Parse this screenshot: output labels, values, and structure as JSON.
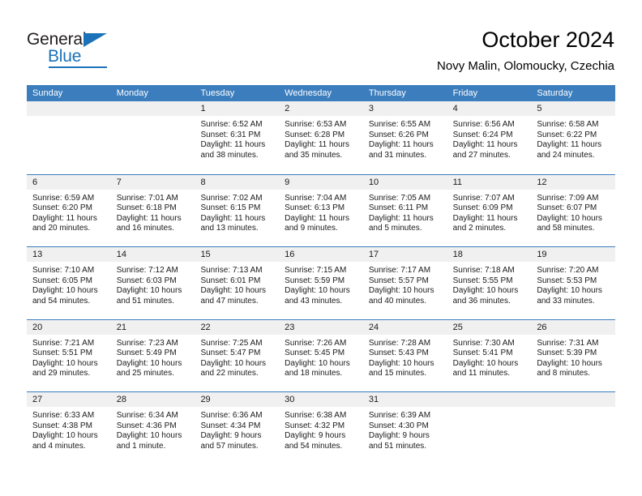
{
  "brand": {
    "name_top": "General",
    "name_bottom": "Blue",
    "accent_color": "#1b72b8"
  },
  "header": {
    "title": "October 2024",
    "subtitle": "Novy Malin, Olomoucky, Czechia"
  },
  "calendar": {
    "header_bg": "#3b7dbd",
    "day_band_bg": "#f0f0f0",
    "weekday_labels": [
      "Sunday",
      "Monday",
      "Tuesday",
      "Wednesday",
      "Thursday",
      "Friday",
      "Saturday"
    ],
    "weeks": [
      [
        {
          "day": "",
          "lines": []
        },
        {
          "day": "",
          "lines": []
        },
        {
          "day": "1",
          "lines": [
            "Sunrise: 6:52 AM",
            "Sunset: 6:31 PM",
            "Daylight: 11 hours",
            "and 38 minutes."
          ]
        },
        {
          "day": "2",
          "lines": [
            "Sunrise: 6:53 AM",
            "Sunset: 6:28 PM",
            "Daylight: 11 hours",
            "and 35 minutes."
          ]
        },
        {
          "day": "3",
          "lines": [
            "Sunrise: 6:55 AM",
            "Sunset: 6:26 PM",
            "Daylight: 11 hours",
            "and 31 minutes."
          ]
        },
        {
          "day": "4",
          "lines": [
            "Sunrise: 6:56 AM",
            "Sunset: 6:24 PM",
            "Daylight: 11 hours",
            "and 27 minutes."
          ]
        },
        {
          "day": "5",
          "lines": [
            "Sunrise: 6:58 AM",
            "Sunset: 6:22 PM",
            "Daylight: 11 hours",
            "and 24 minutes."
          ]
        }
      ],
      [
        {
          "day": "6",
          "lines": [
            "Sunrise: 6:59 AM",
            "Sunset: 6:20 PM",
            "Daylight: 11 hours",
            "and 20 minutes."
          ]
        },
        {
          "day": "7",
          "lines": [
            "Sunrise: 7:01 AM",
            "Sunset: 6:18 PM",
            "Daylight: 11 hours",
            "and 16 minutes."
          ]
        },
        {
          "day": "8",
          "lines": [
            "Sunrise: 7:02 AM",
            "Sunset: 6:15 PM",
            "Daylight: 11 hours",
            "and 13 minutes."
          ]
        },
        {
          "day": "9",
          "lines": [
            "Sunrise: 7:04 AM",
            "Sunset: 6:13 PM",
            "Daylight: 11 hours",
            "and 9 minutes."
          ]
        },
        {
          "day": "10",
          "lines": [
            "Sunrise: 7:05 AM",
            "Sunset: 6:11 PM",
            "Daylight: 11 hours",
            "and 5 minutes."
          ]
        },
        {
          "day": "11",
          "lines": [
            "Sunrise: 7:07 AM",
            "Sunset: 6:09 PM",
            "Daylight: 11 hours",
            "and 2 minutes."
          ]
        },
        {
          "day": "12",
          "lines": [
            "Sunrise: 7:09 AM",
            "Sunset: 6:07 PM",
            "Daylight: 10 hours",
            "and 58 minutes."
          ]
        }
      ],
      [
        {
          "day": "13",
          "lines": [
            "Sunrise: 7:10 AM",
            "Sunset: 6:05 PM",
            "Daylight: 10 hours",
            "and 54 minutes."
          ]
        },
        {
          "day": "14",
          "lines": [
            "Sunrise: 7:12 AM",
            "Sunset: 6:03 PM",
            "Daylight: 10 hours",
            "and 51 minutes."
          ]
        },
        {
          "day": "15",
          "lines": [
            "Sunrise: 7:13 AM",
            "Sunset: 6:01 PM",
            "Daylight: 10 hours",
            "and 47 minutes."
          ]
        },
        {
          "day": "16",
          "lines": [
            "Sunrise: 7:15 AM",
            "Sunset: 5:59 PM",
            "Daylight: 10 hours",
            "and 43 minutes."
          ]
        },
        {
          "day": "17",
          "lines": [
            "Sunrise: 7:17 AM",
            "Sunset: 5:57 PM",
            "Daylight: 10 hours",
            "and 40 minutes."
          ]
        },
        {
          "day": "18",
          "lines": [
            "Sunrise: 7:18 AM",
            "Sunset: 5:55 PM",
            "Daylight: 10 hours",
            "and 36 minutes."
          ]
        },
        {
          "day": "19",
          "lines": [
            "Sunrise: 7:20 AM",
            "Sunset: 5:53 PM",
            "Daylight: 10 hours",
            "and 33 minutes."
          ]
        }
      ],
      [
        {
          "day": "20",
          "lines": [
            "Sunrise: 7:21 AM",
            "Sunset: 5:51 PM",
            "Daylight: 10 hours",
            "and 29 minutes."
          ]
        },
        {
          "day": "21",
          "lines": [
            "Sunrise: 7:23 AM",
            "Sunset: 5:49 PM",
            "Daylight: 10 hours",
            "and 25 minutes."
          ]
        },
        {
          "day": "22",
          "lines": [
            "Sunrise: 7:25 AM",
            "Sunset: 5:47 PM",
            "Daylight: 10 hours",
            "and 22 minutes."
          ]
        },
        {
          "day": "23",
          "lines": [
            "Sunrise: 7:26 AM",
            "Sunset: 5:45 PM",
            "Daylight: 10 hours",
            "and 18 minutes."
          ]
        },
        {
          "day": "24",
          "lines": [
            "Sunrise: 7:28 AM",
            "Sunset: 5:43 PM",
            "Daylight: 10 hours",
            "and 15 minutes."
          ]
        },
        {
          "day": "25",
          "lines": [
            "Sunrise: 7:30 AM",
            "Sunset: 5:41 PM",
            "Daylight: 10 hours",
            "and 11 minutes."
          ]
        },
        {
          "day": "26",
          "lines": [
            "Sunrise: 7:31 AM",
            "Sunset: 5:39 PM",
            "Daylight: 10 hours",
            "and 8 minutes."
          ]
        }
      ],
      [
        {
          "day": "27",
          "lines": [
            "Sunrise: 6:33 AM",
            "Sunset: 4:38 PM",
            "Daylight: 10 hours",
            "and 4 minutes."
          ]
        },
        {
          "day": "28",
          "lines": [
            "Sunrise: 6:34 AM",
            "Sunset: 4:36 PM",
            "Daylight: 10 hours",
            "and 1 minute."
          ]
        },
        {
          "day": "29",
          "lines": [
            "Sunrise: 6:36 AM",
            "Sunset: 4:34 PM",
            "Daylight: 9 hours",
            "and 57 minutes."
          ]
        },
        {
          "day": "30",
          "lines": [
            "Sunrise: 6:38 AM",
            "Sunset: 4:32 PM",
            "Daylight: 9 hours",
            "and 54 minutes."
          ]
        },
        {
          "day": "31",
          "lines": [
            "Sunrise: 6:39 AM",
            "Sunset: 4:30 PM",
            "Daylight: 9 hours",
            "and 51 minutes."
          ]
        },
        {
          "day": "",
          "lines": []
        },
        {
          "day": "",
          "lines": []
        }
      ]
    ]
  }
}
